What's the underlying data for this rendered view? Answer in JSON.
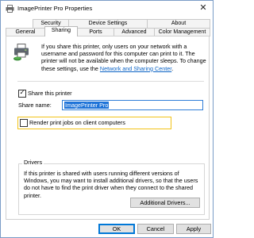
{
  "window": {
    "title": "ImagePrinter Pro Properties",
    "close_glyph": "✕"
  },
  "tabs": {
    "row1": [
      "Security",
      "Device Settings",
      "About"
    ],
    "row2": [
      "General",
      "Sharing",
      "Ports",
      "Advanced",
      "Color Management"
    ],
    "active": "Sharing"
  },
  "sharing": {
    "info_text": "If you share this printer, only users on your network with a username and password for this computer can print to it. The printer will not be available when the computer sleeps. To change these settings, use the ",
    "info_link": "Network and Sharing Center",
    "info_end": ".",
    "share_checkbox_label": "Share this printer",
    "share_checkbox_checked": true,
    "share_name_label": "Share name:",
    "share_name_value": "ImagePrinter Pro",
    "render_checkbox_label": "Render print jobs on client computers",
    "render_checkbox_checked": false,
    "highlight_color": "#f2c318"
  },
  "drivers": {
    "legend": "Drivers",
    "text": "If this printer is shared with users running different versions of Windows, you may want to install additional drivers, so that the users do not have to find the print driver when they connect to the shared printer.",
    "additional_button": "Additional Drivers..."
  },
  "footer": {
    "ok": "OK",
    "cancel": "Cancel",
    "apply": "Apply"
  },
  "icons": {
    "app": "printer-icon",
    "share": "shared-printer-icon",
    "close": "close-icon",
    "check": "checkmark-icon"
  },
  "colors": {
    "link": "#0b63c5",
    "selection": "#1e73d8",
    "focus_border": "#2f7ed8"
  }
}
